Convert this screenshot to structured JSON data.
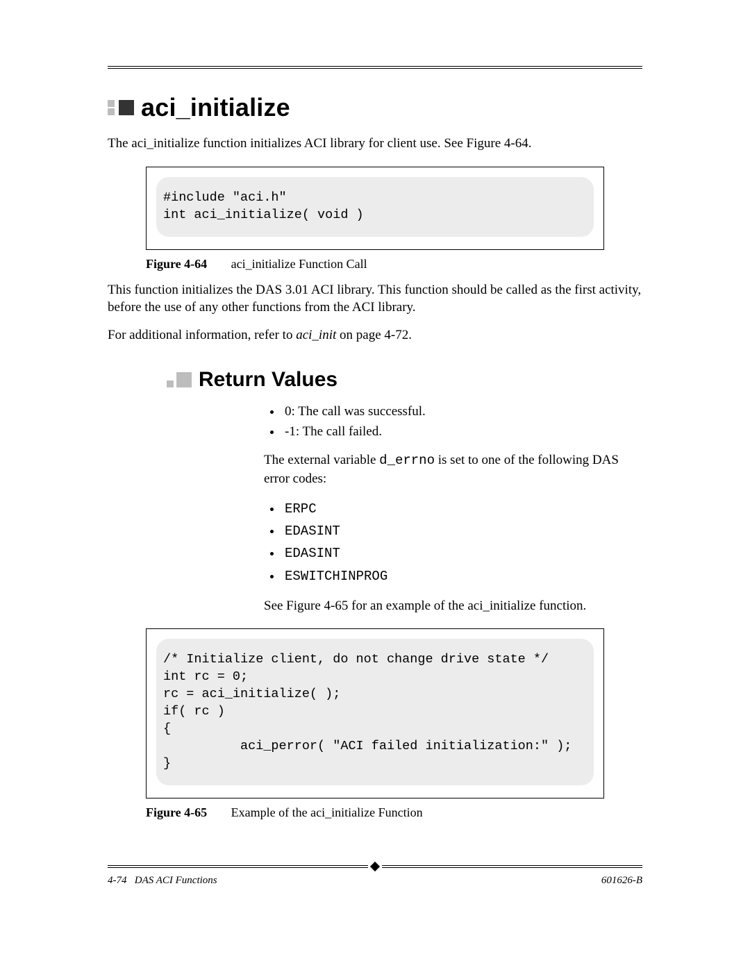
{
  "headings": {
    "h1": "aci_initialize",
    "h2": "Return Values"
  },
  "intro": "The aci_initialize function initializes ACI library for client use. See Figure 4-64.",
  "codebox1": "#include \"aci.h\"\nint aci_initialize( void )",
  "fig1": {
    "label": "Figure 4-64",
    "caption": "aci_initialize Function Call"
  },
  "after_fig1_p1": "This function initializes the DAS 3.01 ACI library. This function should be called as the first activity, before the use of any other functions from the ACI library.",
  "after_fig1_p2_pre": "For additional information, refer to ",
  "after_fig1_p2_em": "aci_init",
  "after_fig1_p2_post": "  on page 4-72.",
  "return_list": [
    "0: The call was successful.",
    "-1: The call failed."
  ],
  "errno_p_pre": "The external variable ",
  "errno_code": "d_errno",
  "errno_p_post": " is set to one of the following DAS error codes:",
  "err_codes": [
    "ERPC",
    "EDASINT",
    "EDASINT",
    "ESWITCHINPROG"
  ],
  "see_fig65": "See Figure 4-65 for an example of the aci_initialize function.",
  "codebox2": "/* Initialize client, do not change drive state */\nint rc = 0;\nrc = aci_initialize( );\nif( rc )\n{\n          aci_perror( \"ACI failed initialization:\" );\n}",
  "fig2": {
    "label": "Figure 4-65",
    "caption": "Example of the aci_initialize Function"
  },
  "footer": {
    "left_page": "4-74",
    "left_title": "DAS ACI Functions",
    "right": "601626-B"
  }
}
